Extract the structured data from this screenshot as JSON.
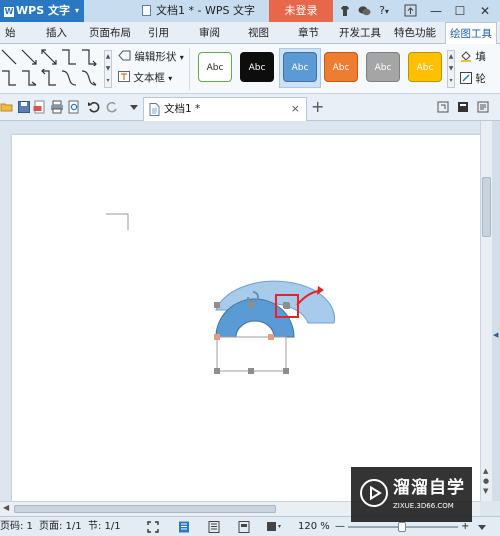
{
  "titlebar": {
    "app_name": "WPS 文字",
    "app_dropdown": "▾",
    "doc_title": "文档1 * - WPS 文字",
    "login": "未登录",
    "help": "?",
    "help_dropdown": "▾",
    "minimize": "—",
    "maximize": "☐",
    "close": "✕"
  },
  "menu": {
    "tabs": [
      "始",
      "插入",
      "页面布局",
      "引用",
      "审阅",
      "视图",
      "章节",
      "开发工具",
      "特色功能",
      "绘图工具"
    ],
    "active_tab": "绘图工具"
  },
  "ribbon": {
    "edit_shape": "编辑形状",
    "text_box": "文本框",
    "dropdown": "▾",
    "styles": [
      {
        "label": "Abc",
        "bg": "#ffffff",
        "fg": "#2a2a2a",
        "border": "#6aa84f"
      },
      {
        "label": "Abc",
        "bg": "#0d0d0d",
        "fg": "#ffffff",
        "border": "#0d0d0d"
      },
      {
        "label": "Abc",
        "bg": "#5b9bd5",
        "fg": "#ffffff",
        "border": "#41719c"
      },
      {
        "label": "Abc",
        "bg": "#ed7d31",
        "fg": "#ffffff",
        "border": "#c55a11"
      },
      {
        "label": "Abc",
        "bg": "#a5a5a5",
        "fg": "#ffffff",
        "border": "#7f7f7f"
      },
      {
        "label": "Abc",
        "bg": "#ffc000",
        "fg": "#ffffff",
        "border": "#bf9000"
      }
    ],
    "fill_label": "填",
    "outline_label": "轮"
  },
  "doctab": {
    "label": "文档1 *",
    "close": "×",
    "new_tab": "+"
  },
  "statusbar": {
    "page_no": "页码: 1",
    "pages": "页面: 1/1",
    "section": "节: 1/1",
    "zoom": "120 %",
    "zoom_minus": "—",
    "zoom_plus": "+"
  },
  "watermark": {
    "title": "溜溜自学",
    "url": "ZIXUE.3D66.COM"
  },
  "colors": {
    "app_blue": "#2b78c2",
    "login_red": "#e8674a",
    "shape_blue": "#5b9bd5",
    "shape_light": "#9dc3e6",
    "highlight_red": "#e0262b"
  }
}
